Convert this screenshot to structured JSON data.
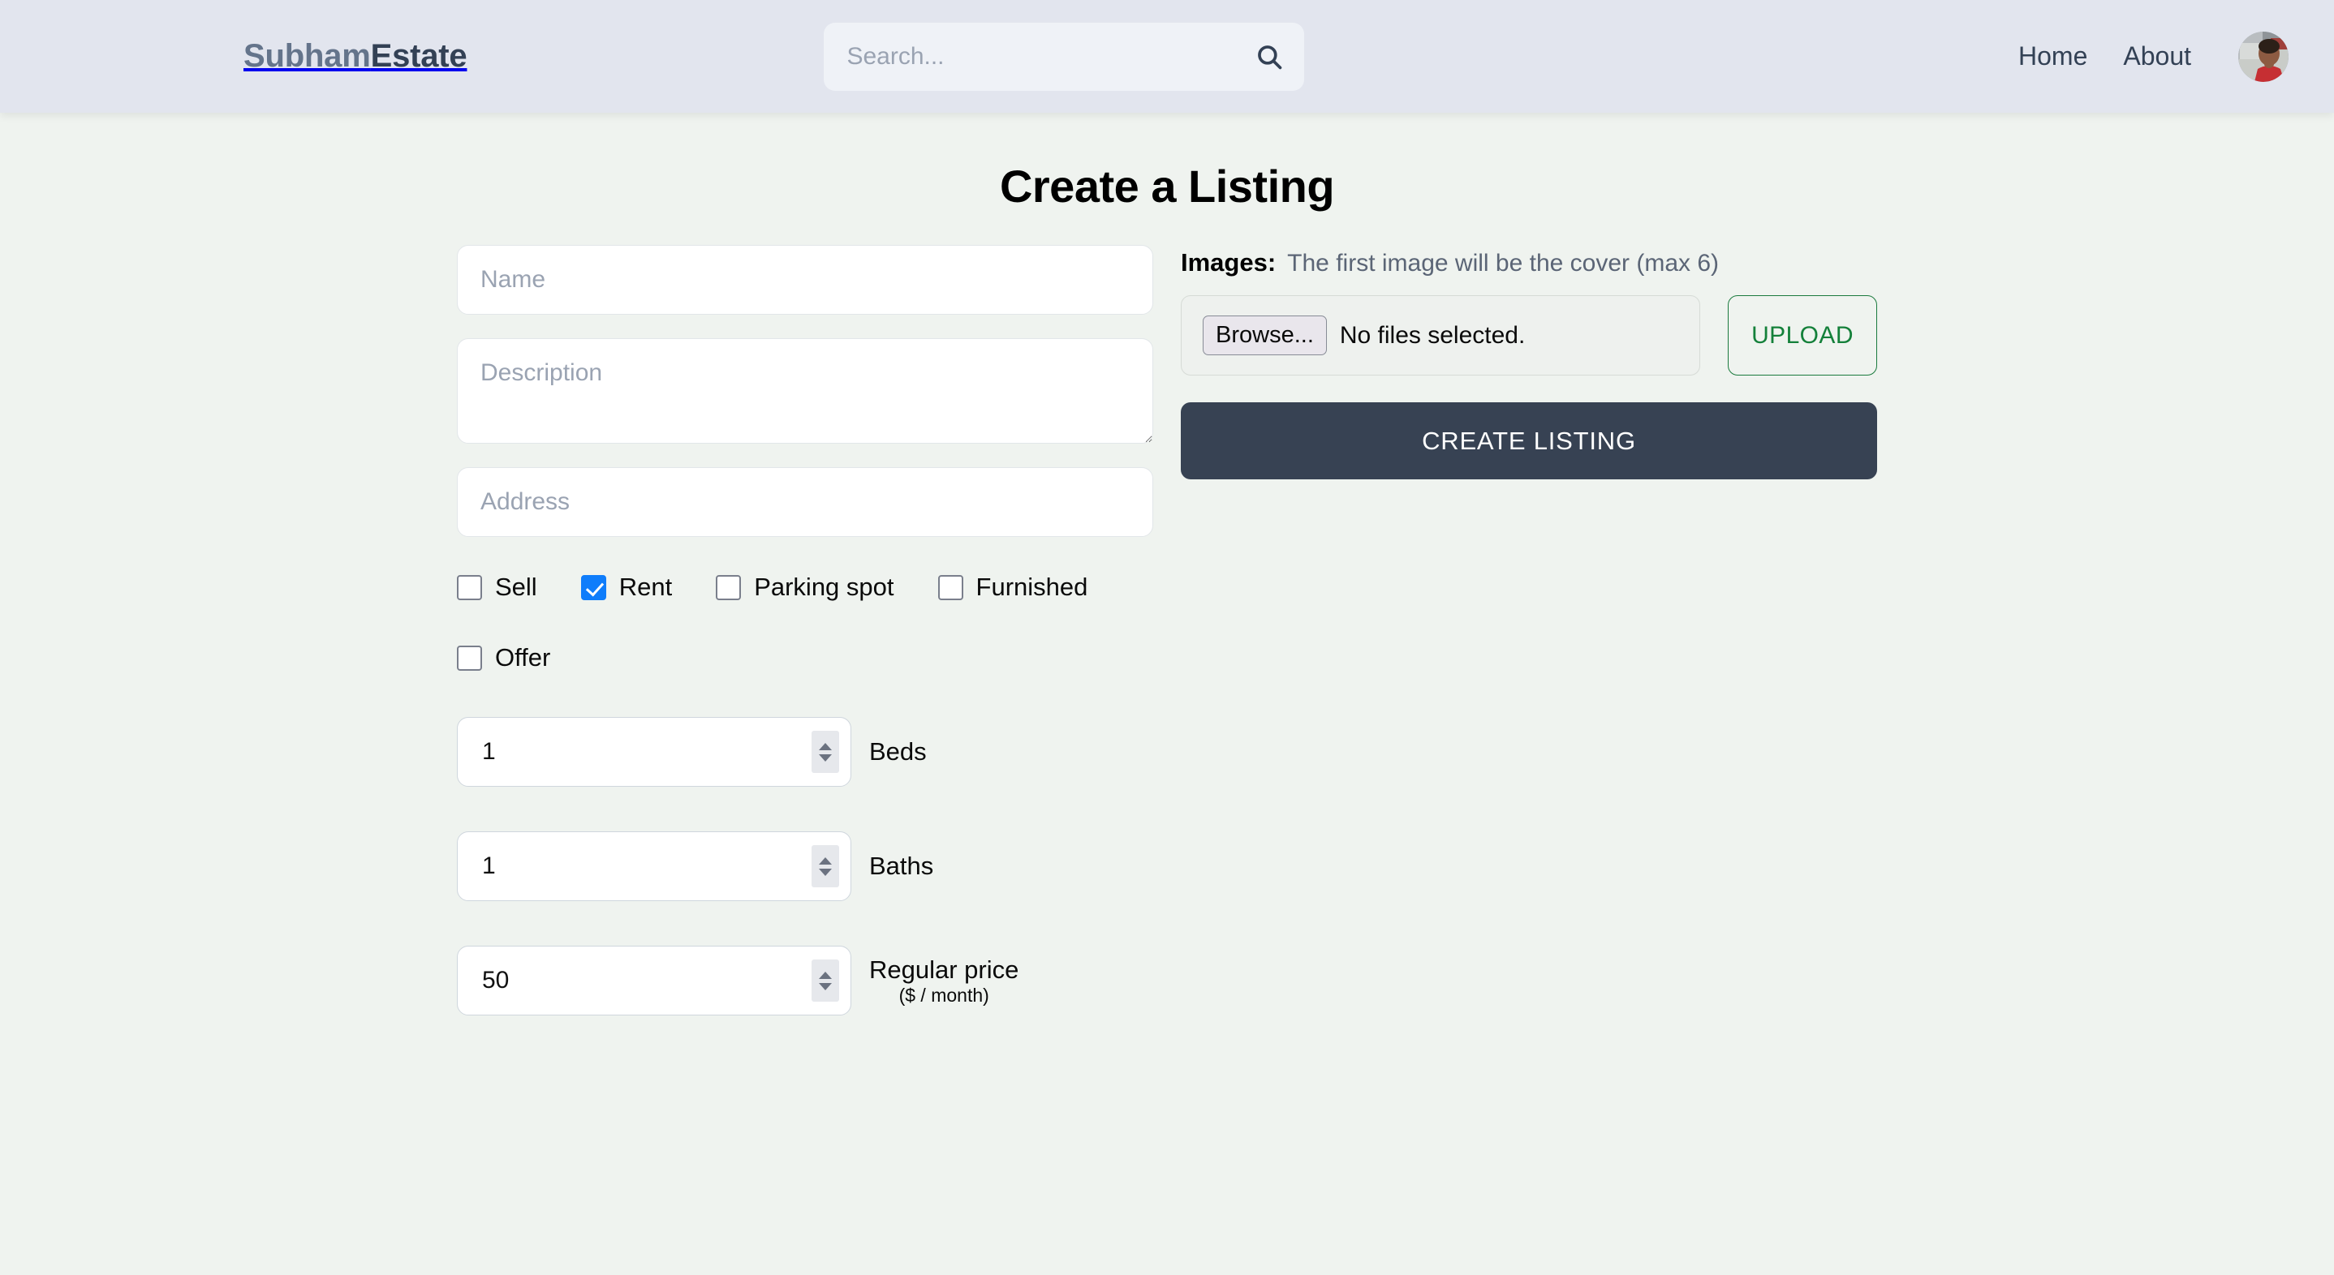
{
  "header": {
    "brand_first": "Subham",
    "brand_second": "Estate",
    "search": {
      "placeholder": "Search...",
      "value": "",
      "icon": "search-icon"
    },
    "nav": [
      {
        "label": "Home"
      },
      {
        "label": "About"
      }
    ],
    "avatar": {
      "alt": "profile-avatar"
    },
    "background_color": "#e2e5ee"
  },
  "main": {
    "title": "Create a Listing",
    "background_color": "#eff3ef",
    "left": {
      "name_placeholder": "Name",
      "name_value": "",
      "description_placeholder": "Description",
      "description_value": "",
      "address_placeholder": "Address",
      "address_value": "",
      "checkboxes_row1": [
        {
          "label": "Sell",
          "checked": false
        },
        {
          "label": "Rent",
          "checked": true
        },
        {
          "label": "Parking spot",
          "checked": false
        },
        {
          "label": "Furnished",
          "checked": false
        }
      ],
      "checkboxes_row2": [
        {
          "label": "Offer",
          "checked": false
        }
      ],
      "checked_color": "#0f7dfb",
      "numbers": [
        {
          "value": "1",
          "label": "Beds",
          "sub": ""
        },
        {
          "value": "1",
          "label": "Baths",
          "sub": ""
        },
        {
          "value": "50",
          "label": "Regular price",
          "sub": "($ / month)"
        }
      ]
    },
    "right": {
      "images_label": "Images:",
      "images_hint": "The first image will be the cover (max 6)",
      "browse_label": "Browse...",
      "file_status": "No files selected.",
      "upload_label": "UPLOAD",
      "upload_color": "#14803a",
      "create_label": "CREATE LISTING",
      "create_color": "#374253"
    }
  }
}
